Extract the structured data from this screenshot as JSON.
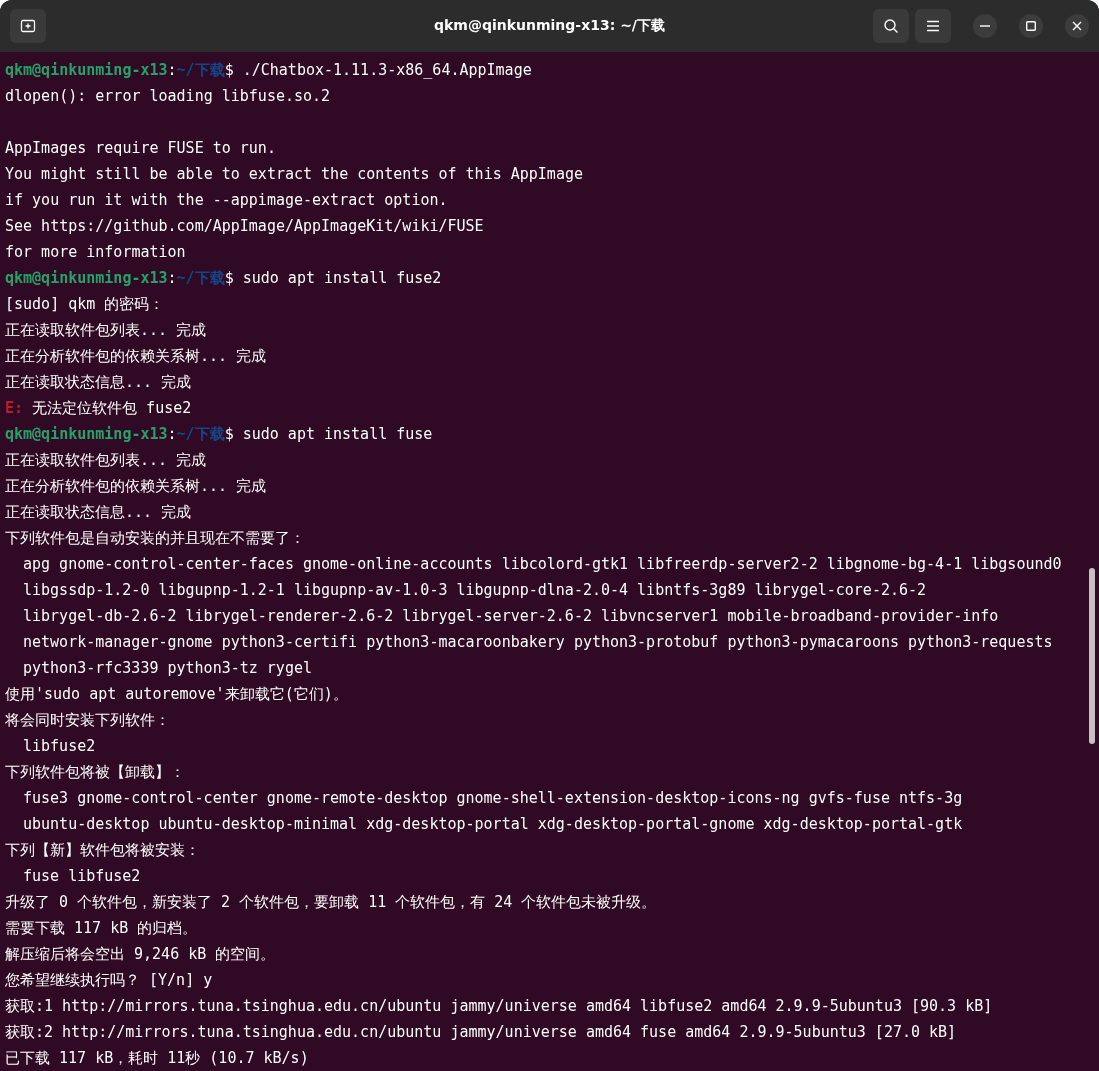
{
  "window": {
    "title": "qkm@qinkunming-x13: ~/下载"
  },
  "terminal": {
    "lines": [
      {
        "kind": "prompt",
        "user": "qkm@qinkunming-x13",
        "separator": ":",
        "path": "~/下载",
        "symbol": "$",
        "command": " ./Chatbox-1.11.3-x86_64.AppImage"
      },
      {
        "kind": "output",
        "text": "dlopen(): error loading libfuse.so.2"
      },
      {
        "kind": "blank"
      },
      {
        "kind": "output",
        "text": "AppImages require FUSE to run."
      },
      {
        "kind": "output",
        "text": "You might still be able to extract the contents of this AppImage"
      },
      {
        "kind": "output",
        "text": "if you run it with the --appimage-extract option."
      },
      {
        "kind": "output",
        "text": "See https://github.com/AppImage/AppImageKit/wiki/FUSE"
      },
      {
        "kind": "output",
        "text": "for more information"
      },
      {
        "kind": "prompt",
        "user": "qkm@qinkunming-x13",
        "separator": ":",
        "path": "~/下载",
        "symbol": "$",
        "command": " sudo apt install fuse2"
      },
      {
        "kind": "output",
        "text": "[sudo] qkm 的密码："
      },
      {
        "kind": "output",
        "text": "正在读取软件包列表... 完成"
      },
      {
        "kind": "output",
        "text": "正在分析软件包的依赖关系树... 完成"
      },
      {
        "kind": "output",
        "text": "正在读取状态信息... 完成"
      },
      {
        "kind": "error",
        "label": "E:",
        "text": " 无法定位软件包 fuse2"
      },
      {
        "kind": "prompt",
        "user": "qkm@qinkunming-x13",
        "separator": ":",
        "path": "~/下载",
        "symbol": "$",
        "command": " sudo apt install fuse"
      },
      {
        "kind": "output",
        "text": "正在读取软件包列表... 完成"
      },
      {
        "kind": "output",
        "text": "正在分析软件包的依赖关系树... 完成"
      },
      {
        "kind": "output",
        "text": "正在读取状态信息... 完成"
      },
      {
        "kind": "output",
        "text": "下列软件包是自动安装的并且现在不需要了："
      },
      {
        "kind": "indented",
        "text": "apg gnome-control-center-faces gnome-online-accounts libcolord-gtk1 libfreerdp-server2-2 libgnome-bg-4-1 libgsound0"
      },
      {
        "kind": "indented",
        "text": "libgssdp-1.2-0 libgupnp-1.2-1 libgupnp-av-1.0-3 libgupnp-dlna-2.0-4 libntfs-3g89 librygel-core-2.6-2"
      },
      {
        "kind": "indented",
        "text": "librygel-db-2.6-2 librygel-renderer-2.6-2 librygel-server-2.6-2 libvncserver1 mobile-broadband-provider-info"
      },
      {
        "kind": "indented",
        "text": "network-manager-gnome python3-certifi python3-macaroonbakery python3-protobuf python3-pymacaroons python3-requests"
      },
      {
        "kind": "indented",
        "text": "python3-rfc3339 python3-tz rygel"
      },
      {
        "kind": "output",
        "text": "使用'sudo apt autoremove'来卸载它(它们)。"
      },
      {
        "kind": "output",
        "text": "将会同时安装下列软件："
      },
      {
        "kind": "indented",
        "text": "libfuse2"
      },
      {
        "kind": "output",
        "text": "下列软件包将被【卸载】："
      },
      {
        "kind": "indented",
        "text": "fuse3 gnome-control-center gnome-remote-desktop gnome-shell-extension-desktop-icons-ng gvfs-fuse ntfs-3g"
      },
      {
        "kind": "indented",
        "text": "ubuntu-desktop ubuntu-desktop-minimal xdg-desktop-portal xdg-desktop-portal-gnome xdg-desktop-portal-gtk"
      },
      {
        "kind": "output",
        "text": "下列【新】软件包将被安装："
      },
      {
        "kind": "indented",
        "text": "fuse libfuse2"
      },
      {
        "kind": "output",
        "text": "升级了 0 个软件包，新安装了 2 个软件包，要卸载 11 个软件包，有 24 个软件包未被升级。"
      },
      {
        "kind": "output",
        "text": "需要下载 117 kB 的归档。"
      },
      {
        "kind": "output",
        "text": "解压缩后将会空出 9,246 kB 的空间。"
      },
      {
        "kind": "output",
        "text": "您希望继续执行吗？ [Y/n] y"
      },
      {
        "kind": "output",
        "text": "获取:1 http://mirrors.tuna.tsinghua.edu.cn/ubuntu jammy/universe amd64 libfuse2 amd64 2.9.9-5ubuntu3 [90.3 kB]"
      },
      {
        "kind": "output",
        "text": "获取:2 http://mirrors.tuna.tsinghua.edu.cn/ubuntu jammy/universe amd64 fuse amd64 2.9.9-5ubuntu3 [27.0 kB]"
      },
      {
        "kind": "output",
        "text": "已下载 117 kB，耗时 11秒 (10.7 kB/s)"
      }
    ]
  }
}
